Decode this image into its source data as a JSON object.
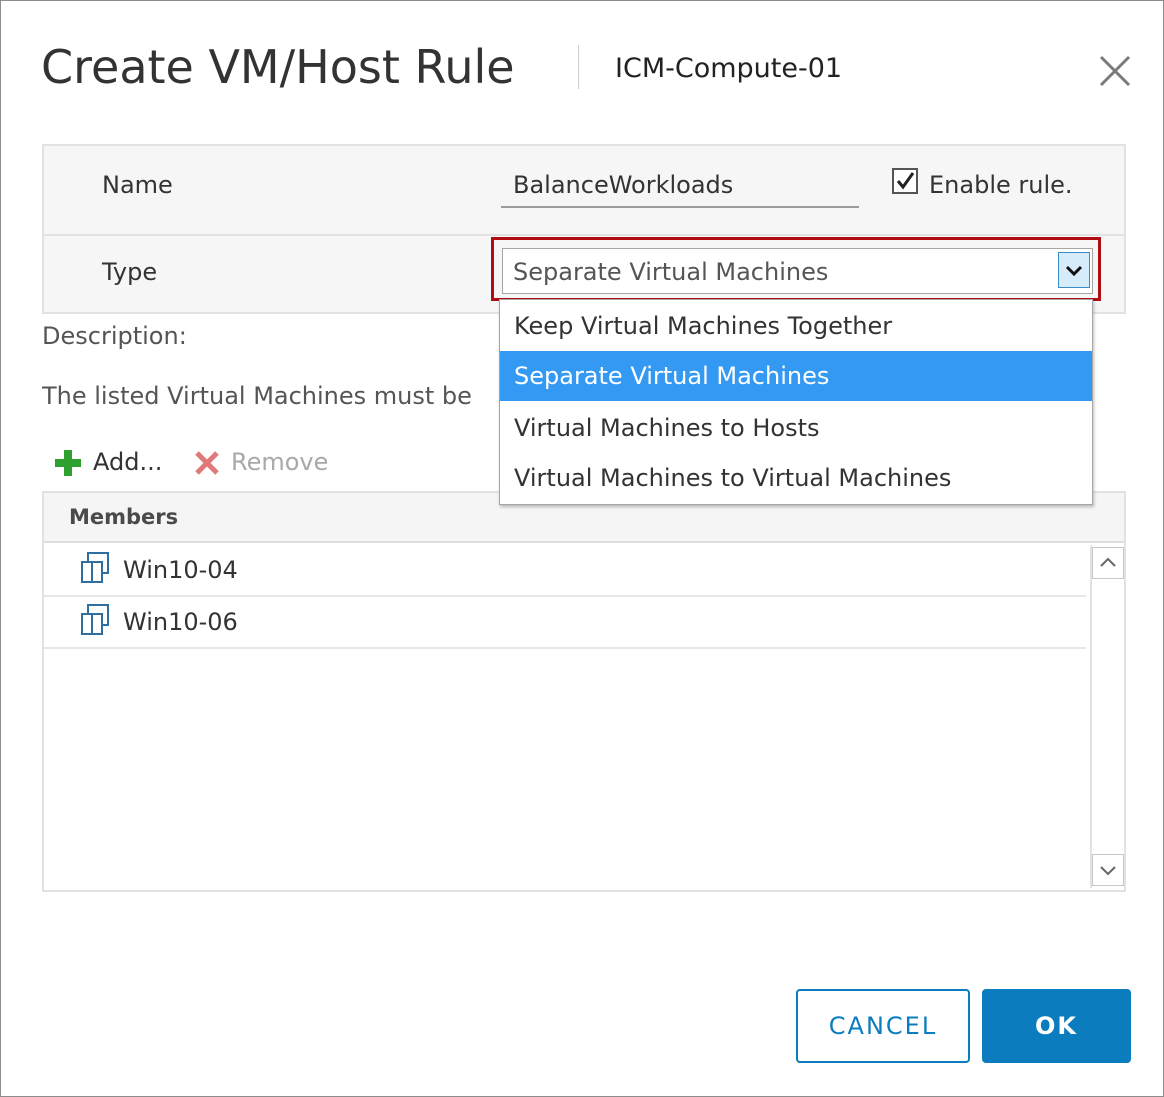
{
  "dialog": {
    "title": "Create VM/Host Rule",
    "cluster_name": "ICM-Compute-01",
    "close_icon": "close-icon"
  },
  "form": {
    "name_label": "Name",
    "name_value": "BalanceWorkloads",
    "enable_rule_label": "Enable rule.",
    "enable_rule_checked": true,
    "type_label": "Type",
    "type_selected": "Separate Virtual Machines",
    "type_options": [
      "Keep Virtual Machines Together",
      "Separate Virtual Machines",
      "Virtual Machines to Hosts",
      "Virtual Machines to Virtual Machines"
    ],
    "highlight_color": "#b00d12"
  },
  "description": {
    "label": "Description:",
    "text": "The listed Virtual Machines must be"
  },
  "toolbar": {
    "add_label": "Add...",
    "remove_label": "Remove",
    "add_icon": "plus-icon",
    "remove_icon": "x-icon"
  },
  "members": {
    "header": "Members",
    "rows": [
      {
        "name": "Win10-04",
        "icon": "vm-icon"
      },
      {
        "name": "Win10-06",
        "icon": "vm-icon"
      }
    ]
  },
  "buttons": {
    "cancel_label": "CANCEL",
    "ok_label": "OK"
  },
  "colors": {
    "accent": "#0b7dbf",
    "selected_option": "#3399f3",
    "add_green": "#2ea02e",
    "remove_red": "#e07a7a"
  }
}
